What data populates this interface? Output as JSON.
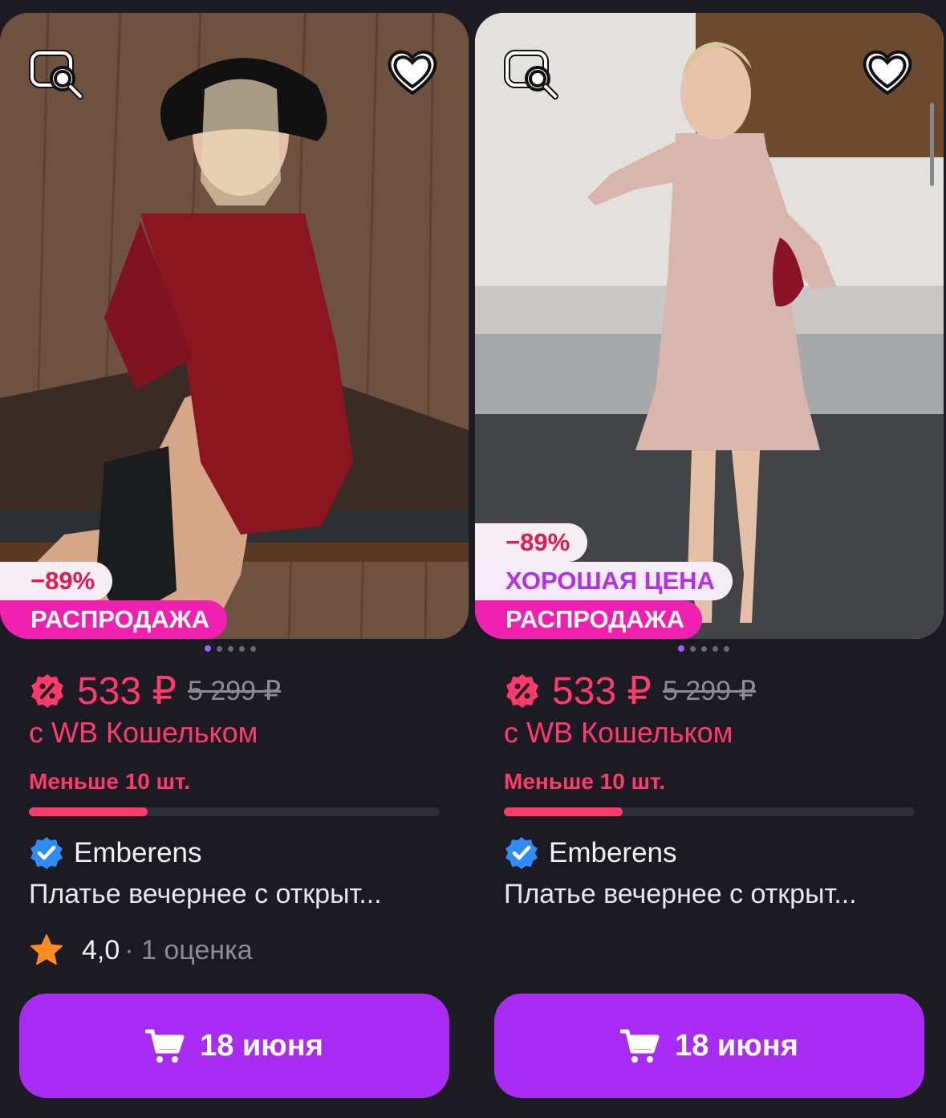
{
  "colors": {
    "background": "#1c1a22",
    "price": "#ff3b6b",
    "button": "#a82cf3",
    "sale_badge": "#f020b0",
    "good_price_text": "#b62ee6"
  },
  "products": [
    {
      "discount_badge": "−89%",
      "good_price_badge": "",
      "sale_badge": "РАСПРОДАЖА",
      "image_icon_left": "image-search-icon",
      "image_icon_right": "heart-icon",
      "price": "533 ₽",
      "old_price": "5 299 ₽",
      "wallet_text": "с WB Кошельком",
      "stock_text": "Меньше 10 шт.",
      "stock_level": 0.29,
      "brand": "Emberens",
      "title": "Платье вечернее с открыт...",
      "rating": "4,0",
      "reviews": "· 1 оценка",
      "buy_label": "18 июня"
    },
    {
      "discount_badge": "−89%",
      "good_price_badge": "ХОРОШАЯ ЦЕНА",
      "sale_badge": "РАСПРОДАЖА",
      "image_icon_left": "image-search-icon",
      "image_icon_right": "heart-icon",
      "price": "533 ₽",
      "old_price": "5 299 ₽",
      "wallet_text": "с WB Кошельком",
      "stock_text": "Меньше 10 шт.",
      "stock_level": 0.29,
      "brand": "Emberens",
      "title": "Платье вечернее с открыт...",
      "rating": "",
      "reviews": "",
      "buy_label": "18 июня"
    }
  ]
}
